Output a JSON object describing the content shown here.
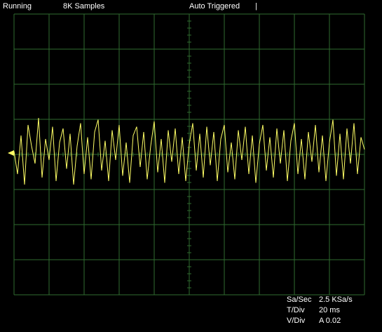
{
  "status": {
    "run_state": "Running",
    "samples": "8K Samples",
    "trigger_mode": "Auto Triggered",
    "cursor_marker": "|"
  },
  "readouts": {
    "sample_rate_label": "Sa/Sec",
    "sample_rate_value": "2.5 KSa/s",
    "time_div_label": "T/Div",
    "time_div_value": "20 ms",
    "volt_div_label": "V/Div",
    "volt_div_value": "A 0.02"
  },
  "colors": {
    "background": "#000000",
    "grid": "#2f6b2f",
    "trace": "#ffff66",
    "text": "#ffffff"
  },
  "chart_data": {
    "type": "line",
    "grid": true,
    "divisions": {
      "horizontal": 10,
      "vertical": 8
    },
    "time_per_div_ms": 20,
    "volts_per_div": 0.02,
    "x_range_ms": [
      0,
      200
    ],
    "y_range_V": [
      -0.08,
      0.08
    ],
    "series": [
      {
        "channel": "A",
        "x_ms": [
          0,
          2,
          4,
          6,
          8,
          10,
          12,
          14,
          16,
          18,
          20,
          22,
          24,
          26,
          28,
          30,
          32,
          34,
          36,
          38,
          40,
          42,
          44,
          46,
          48,
          50,
          52,
          54,
          56,
          58,
          60,
          62,
          64,
          66,
          68,
          70,
          72,
          74,
          76,
          78,
          80,
          82,
          84,
          86,
          88,
          90,
          92,
          94,
          96,
          98,
          100,
          102,
          104,
          106,
          108,
          110,
          112,
          114,
          116,
          118,
          120,
          122,
          124,
          126,
          128,
          130,
          132,
          134,
          136,
          138,
          140,
          142,
          144,
          146,
          148,
          150,
          152,
          154,
          156,
          158,
          160,
          162,
          164,
          166,
          168,
          170,
          172,
          174,
          176,
          178,
          180,
          182,
          184,
          186,
          188,
          190,
          192,
          194,
          196,
          198,
          200
        ],
        "y_V": [
          0.001,
          -0.012,
          0.01,
          -0.018,
          0.016,
          0.004,
          -0.006,
          0.02,
          -0.014,
          0.008,
          -0.004,
          0.015,
          -0.016,
          0.006,
          0.014,
          -0.009,
          0.011,
          -0.018,
          0.004,
          0.017,
          -0.012,
          0.009,
          -0.015,
          0.012,
          0.019,
          -0.01,
          0.007,
          -0.016,
          0.013,
          -0.004,
          0.016,
          -0.013,
          0.006,
          -0.017,
          0.01,
          0.015,
          -0.008,
          0.012,
          -0.015,
          0.004,
          0.018,
          -0.011,
          0.008,
          -0.017,
          0.013,
          -0.005,
          0.014,
          -0.012,
          0.009,
          -0.016,
          0.005,
          0.017,
          -0.01,
          0.011,
          -0.014,
          0.015,
          -0.007,
          0.012,
          -0.016,
          0.008,
          0.016,
          -0.011,
          0.006,
          -0.015,
          0.013,
          -0.004,
          0.015,
          -0.012,
          0.01,
          -0.017,
          0.005,
          0.016,
          -0.01,
          0.009,
          -0.014,
          0.014,
          -0.006,
          0.013,
          -0.016,
          0.007,
          0.017,
          -0.012,
          0.008,
          -0.015,
          0.012,
          -0.005,
          0.016,
          -0.011,
          0.01,
          -0.016,
          0.006,
          0.019,
          -0.013,
          0.011,
          -0.015,
          0.014,
          -0.006,
          0.017,
          -0.012,
          0.009,
          0.002
        ]
      }
    ]
  }
}
